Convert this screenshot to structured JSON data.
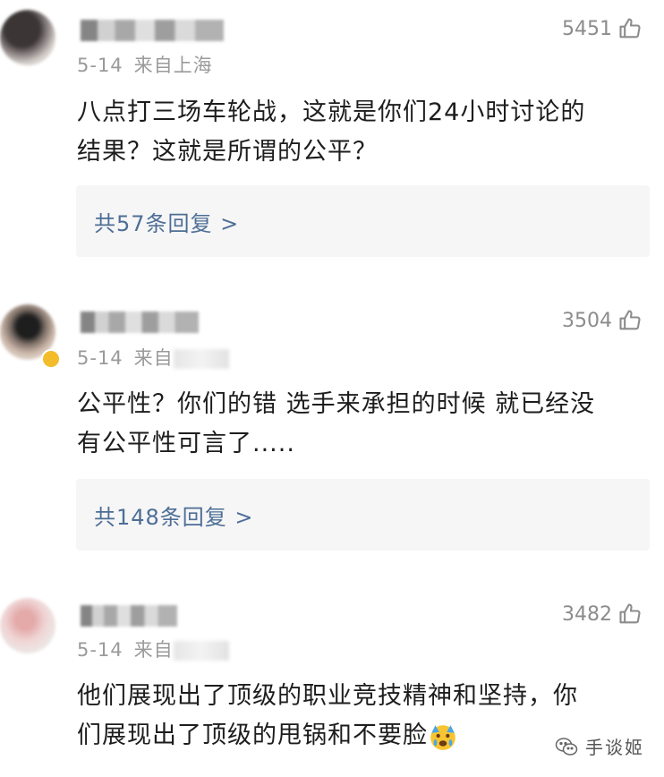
{
  "comments": [
    {
      "likes": "5451",
      "date": "5-14",
      "location": "来自上海",
      "text_line1": "八点打三场车轮战，这就是你们24小时讨论的",
      "text_line2": "结果？这就是所谓的公平？",
      "replies": "共57条回复 >"
    },
    {
      "likes": "3504",
      "date": "5-14",
      "location": "来自",
      "text_line1": "公平性？你们的错 选手来承担的时候 就已经没",
      "text_line2": "有公平性可言了.....",
      "replies": "共148条回复 >"
    },
    {
      "likes": "3482",
      "date": "5-14",
      "location": "来自",
      "text_line1": "他们展现出了顶级的职业竞技精神和坚持，你",
      "text_line2": "们展现出了顶级的甩锅和不要脸"
    }
  ],
  "watermark": "手谈姬",
  "icons": {
    "like": "thumbs-up-icon",
    "emoji": "crying-face-emoji",
    "watermark": "wechat-icon"
  },
  "colors": {
    "reply_link": "#4e6e96",
    "meta_gray": "#9a9a9a"
  }
}
